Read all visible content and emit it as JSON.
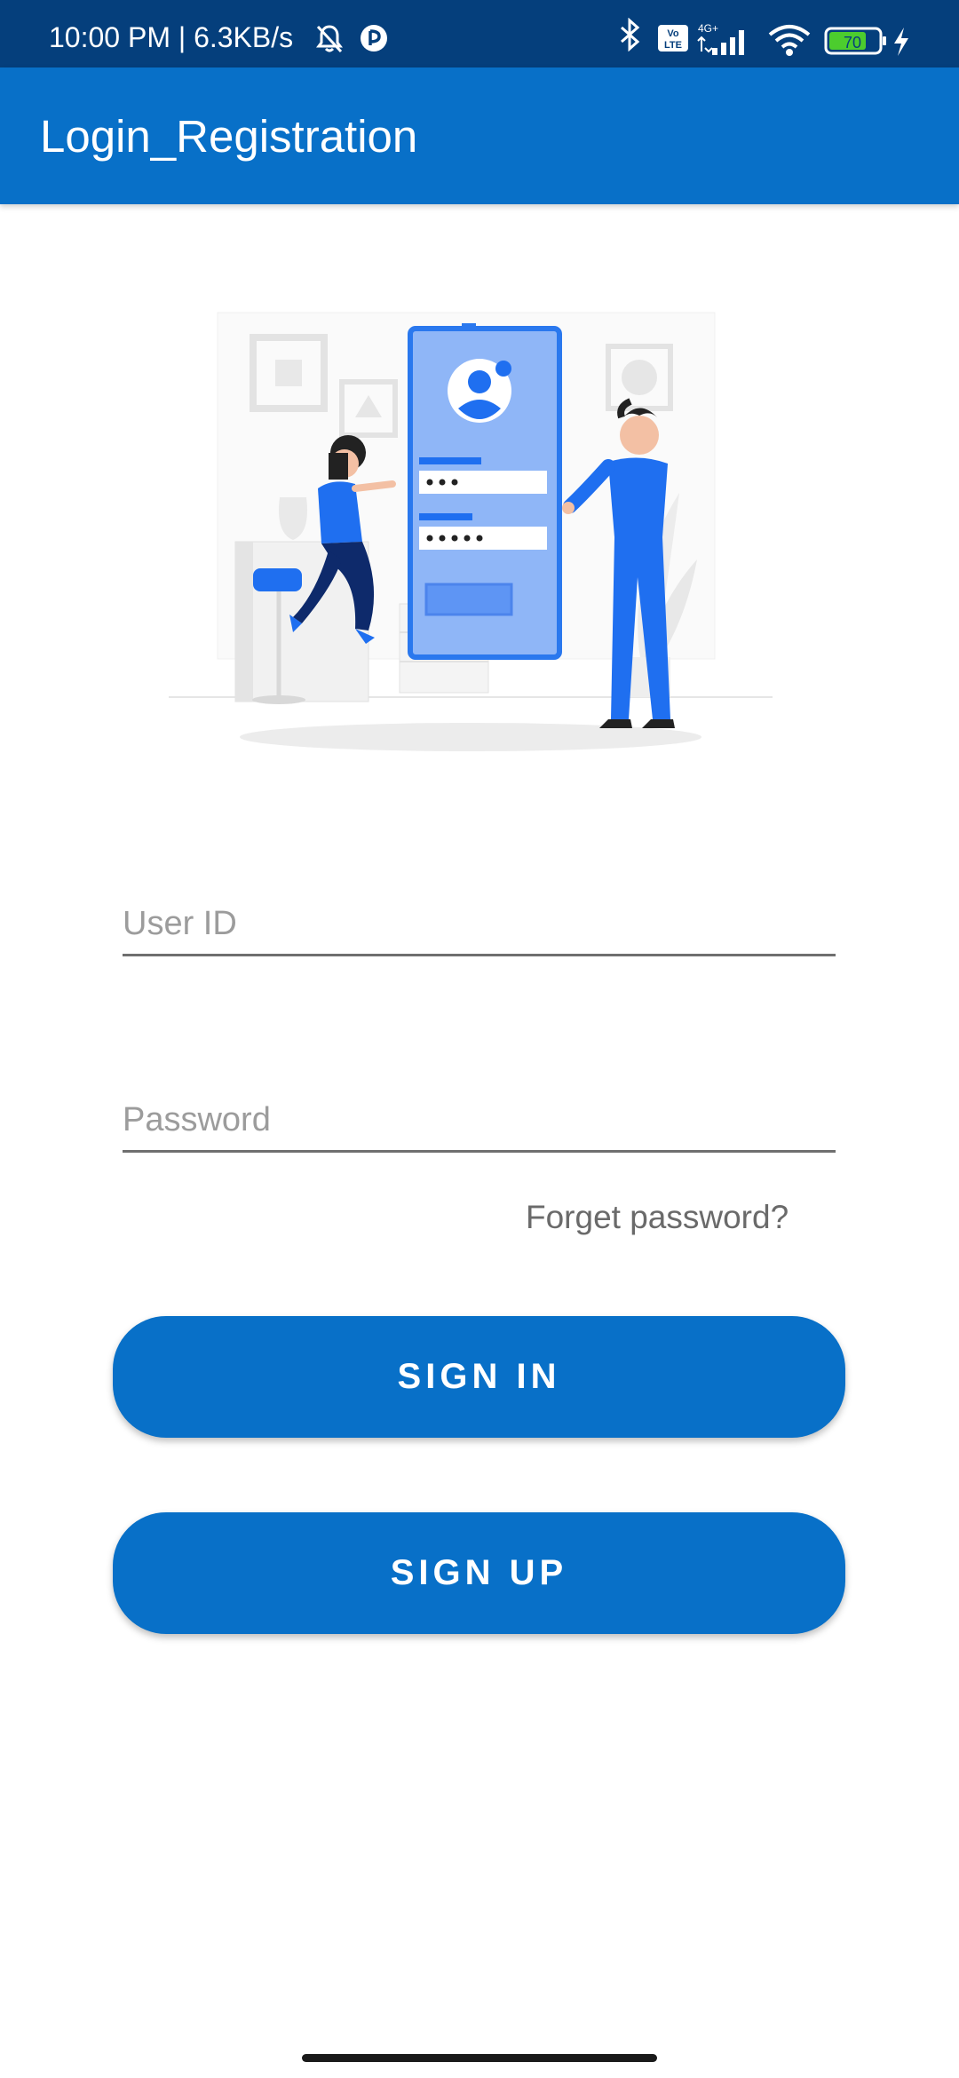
{
  "status_bar": {
    "time_speed": "10:00 PM | 6.3KB/s",
    "network_label": "4G+",
    "volte_label": "Vo LTE",
    "battery_level": "70",
    "icons": [
      "bell-off-icon",
      "app-icon",
      "bluetooth-icon",
      "volte-icon",
      "signal-icon",
      "wifi-icon",
      "battery-icon",
      "charging-icon"
    ]
  },
  "app_bar": {
    "title": "Login_Registration"
  },
  "form": {
    "user_id_placeholder": "User ID",
    "password_placeholder": "Password",
    "forget_password": "Forget password?",
    "sign_in": "SIGN IN",
    "sign_up": "SIGN UP"
  },
  "colors": {
    "status_bar": "#053f7c",
    "primary": "#0870c8",
    "illustration_blue": "#1f6ff0",
    "illustration_light": "#8fb6f7"
  }
}
